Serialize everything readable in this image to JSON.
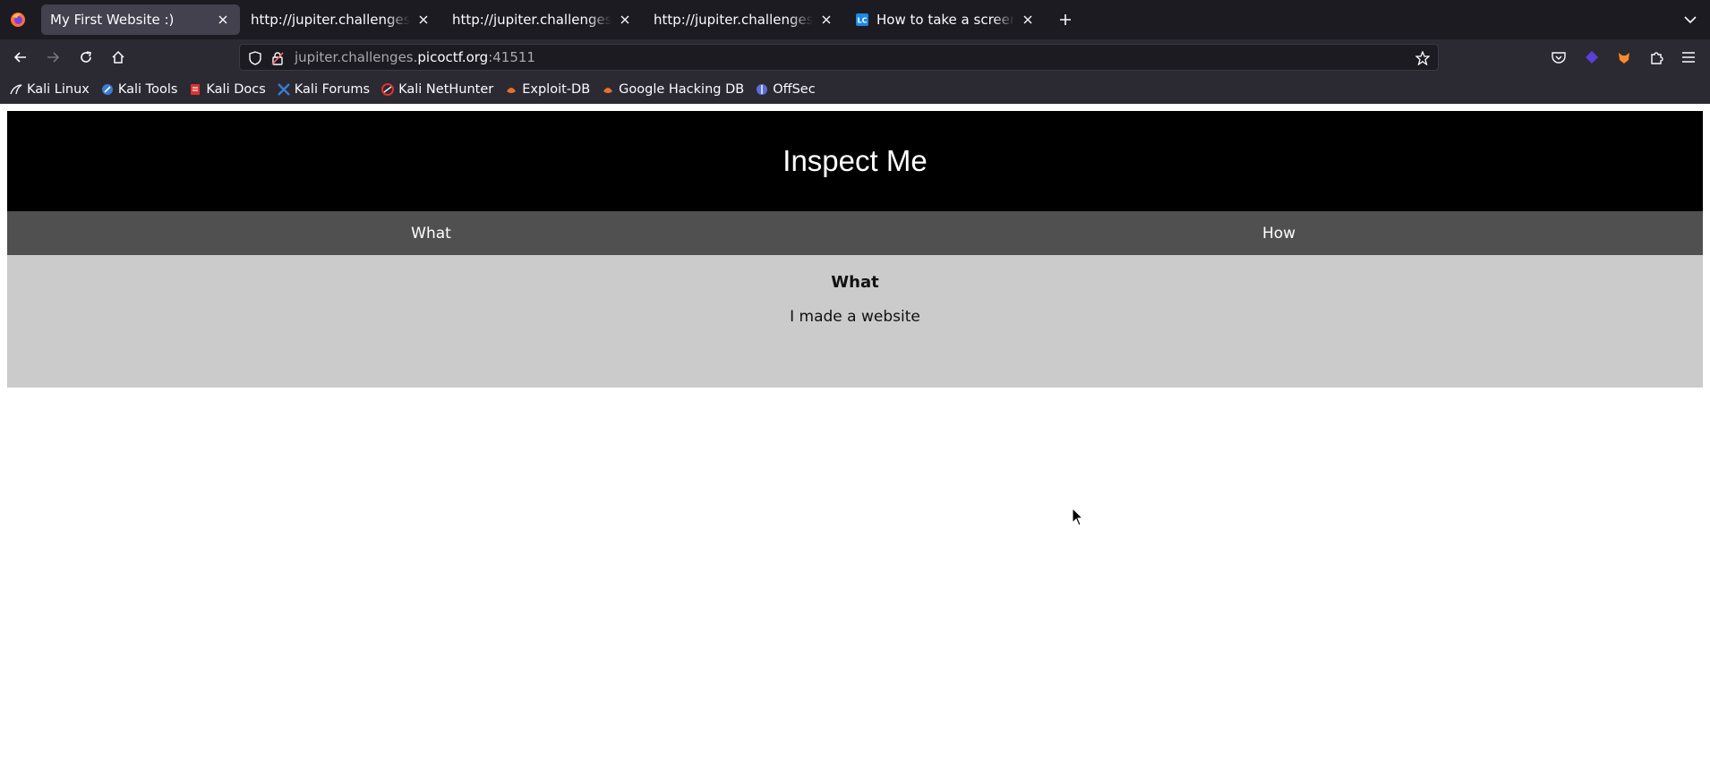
{
  "browser": {
    "tabs": [
      {
        "title": "My First Website :)",
        "active": true,
        "favicon": "none"
      },
      {
        "title": "http://jupiter.challenges.picoctf.org",
        "active": false,
        "favicon": "none"
      },
      {
        "title": "http://jupiter.challenges.picoctf.org",
        "active": false,
        "favicon": "none"
      },
      {
        "title": "http://jupiter.challenges.picoctf.org",
        "active": false,
        "favicon": "none"
      },
      {
        "title": "How to take a screenshot",
        "active": false,
        "favicon": "lc-icon"
      }
    ],
    "url": {
      "subdomain": "jupiter.challenges.",
      "domain": "picoctf.org",
      "port": ":41511"
    },
    "bookmarks": [
      {
        "label": "Kali Linux",
        "icon": "kali-dragon-icon",
        "color": "#e8e8e8"
      },
      {
        "label": "Kali Tools",
        "icon": "kali-tools-icon",
        "color": "#3a7bd5"
      },
      {
        "label": "Kali Docs",
        "icon": "kali-docs-icon",
        "color": "#e0312f"
      },
      {
        "label": "Kali Forums",
        "icon": "kali-forums-icon",
        "color": "#3a7bd5"
      },
      {
        "label": "Kali NetHunter",
        "icon": "nethunter-icon",
        "color": "#e0312f"
      },
      {
        "label": "Exploit-DB",
        "icon": "exploit-db-icon",
        "color": "#e8702a"
      },
      {
        "label": "Google Hacking DB",
        "icon": "ghdb-icon",
        "color": "#e8702a"
      },
      {
        "label": "OffSec",
        "icon": "offsec-icon",
        "color": "#5b6dd6"
      }
    ],
    "colors": {
      "tabstrip": "#1c1b22",
      "toolbar": "#2b2a33",
      "active_tab": "#42414d"
    }
  },
  "site": {
    "title": "Inspect Me",
    "nav": [
      {
        "label": "What"
      },
      {
        "label": "How"
      }
    ],
    "panel": {
      "heading": "What",
      "text": "I made a website"
    },
    "colors": {
      "header": "#000000",
      "nav": "#505050",
      "panel": "#cbcbcb"
    }
  }
}
